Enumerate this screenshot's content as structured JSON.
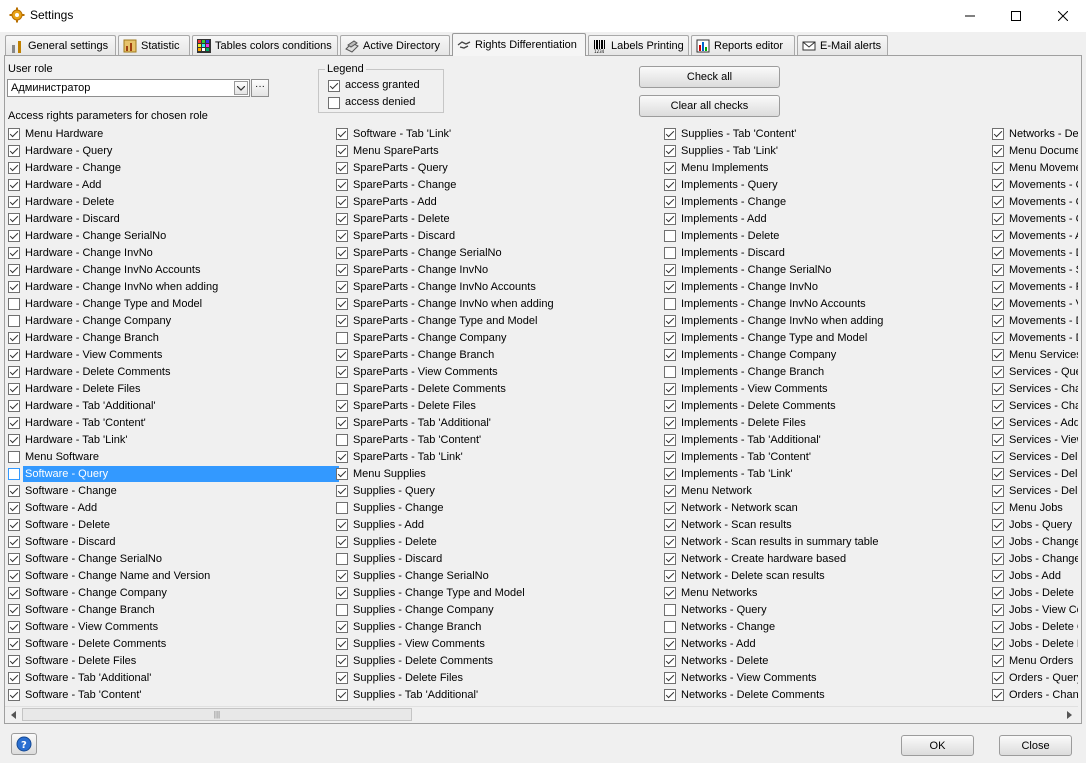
{
  "window": {
    "title": "Settings"
  },
  "tabs": [
    {
      "label": "General settings",
      "icon": "tools-icon",
      "active": false
    },
    {
      "label": "Statistic",
      "icon": "chart-icon",
      "active": false
    },
    {
      "label": "Tables colors conditions",
      "icon": "color-grid-icon",
      "active": false
    },
    {
      "label": "Active Directory",
      "icon": "directory-icon",
      "active": false
    },
    {
      "label": "Rights Differentiation",
      "icon": "handshake-icon",
      "active": true
    },
    {
      "label": "Labels Printing",
      "icon": "barcode-icon",
      "active": false
    },
    {
      "label": "Reports editor",
      "icon": "report-icon",
      "active": false
    },
    {
      "label": "E-Mail alerts",
      "icon": "email-icon",
      "active": false
    }
  ],
  "user_role": {
    "label": "User role",
    "value": "Администратор"
  },
  "legend": {
    "title": "Legend",
    "granted": "access granted",
    "denied": "access denied"
  },
  "buttons": {
    "check_all": "Check all",
    "clear_all": "Clear all checks",
    "ok": "OK",
    "close": "Close"
  },
  "section_label": "Access rights parameters for chosen role",
  "columns": [
    [
      {
        "label": "Menu Hardware",
        "checked": true
      },
      {
        "label": "Hardware - Query",
        "checked": true
      },
      {
        "label": "Hardware - Change",
        "checked": true
      },
      {
        "label": "Hardware - Add",
        "checked": true
      },
      {
        "label": "Hardware - Delete",
        "checked": true
      },
      {
        "label": "Hardware - Discard",
        "checked": true
      },
      {
        "label": "Hardware - Change SerialNo",
        "checked": true
      },
      {
        "label": "Hardware - Change InvNo",
        "checked": true
      },
      {
        "label": "Hardware - Change InvNo Accounts",
        "checked": true
      },
      {
        "label": "Hardware - Change InvNo when adding",
        "checked": true
      },
      {
        "label": "Hardware - Change Type and Model",
        "checked": false
      },
      {
        "label": "Hardware - Change Company",
        "checked": false
      },
      {
        "label": "Hardware - Change Branch",
        "checked": true
      },
      {
        "label": "Hardware - View Comments",
        "checked": true
      },
      {
        "label": "Hardware - Delete Comments",
        "checked": true
      },
      {
        "label": "Hardware - Delete Files",
        "checked": true
      },
      {
        "label": "Hardware - Tab 'Additional'",
        "checked": true
      },
      {
        "label": "Hardware - Tab 'Content'",
        "checked": true
      },
      {
        "label": "Hardware - Tab 'Link'",
        "checked": true
      },
      {
        "label": "Menu Software",
        "checked": false
      },
      {
        "label": "Software - Query",
        "checked": false,
        "selected": true
      },
      {
        "label": "Software - Change",
        "checked": true
      },
      {
        "label": "Software - Add",
        "checked": true
      },
      {
        "label": "Software - Delete",
        "checked": true
      },
      {
        "label": "Software - Discard",
        "checked": true
      },
      {
        "label": "Software - Change SerialNo",
        "checked": true
      },
      {
        "label": "Software - Change Name and Version",
        "checked": true
      },
      {
        "label": "Software - Change Company",
        "checked": true
      },
      {
        "label": "Software - Change Branch",
        "checked": true
      },
      {
        "label": "Software - View Comments",
        "checked": true
      },
      {
        "label": "Software - Delete Comments",
        "checked": true
      },
      {
        "label": "Software - Delete Files",
        "checked": true
      },
      {
        "label": "Software - Tab 'Additional'",
        "checked": true
      },
      {
        "label": "Software - Tab 'Content'",
        "checked": true
      }
    ],
    [
      {
        "label": "Software - Tab 'Link'",
        "checked": true
      },
      {
        "label": "Menu SpareParts",
        "checked": true
      },
      {
        "label": "SpareParts - Query",
        "checked": true
      },
      {
        "label": "SpareParts - Change",
        "checked": true
      },
      {
        "label": "SpareParts - Add",
        "checked": true
      },
      {
        "label": "SpareParts - Delete",
        "checked": true
      },
      {
        "label": "SpareParts - Discard",
        "checked": true
      },
      {
        "label": "SpareParts - Change SerialNo",
        "checked": true
      },
      {
        "label": "SpareParts - Change InvNo",
        "checked": true
      },
      {
        "label": "SpareParts - Change InvNo Accounts",
        "checked": true
      },
      {
        "label": "SpareParts - Change InvNo when adding",
        "checked": true
      },
      {
        "label": "SpareParts - Change Type and Model",
        "checked": true
      },
      {
        "label": "SpareParts - Change Company",
        "checked": false
      },
      {
        "label": "SpareParts - Change Branch",
        "checked": true
      },
      {
        "label": "SpareParts - View Comments",
        "checked": true
      },
      {
        "label": "SpareParts - Delete Comments",
        "checked": false
      },
      {
        "label": "SpareParts - Delete Files",
        "checked": true
      },
      {
        "label": "SpareParts - Tab 'Additional'",
        "checked": true
      },
      {
        "label": "SpareParts - Tab 'Content'",
        "checked": false
      },
      {
        "label": "SpareParts - Tab 'Link'",
        "checked": true
      },
      {
        "label": "Menu Supplies",
        "checked": true
      },
      {
        "label": "Supplies - Query",
        "checked": true
      },
      {
        "label": "Supplies - Change",
        "checked": false
      },
      {
        "label": "Supplies - Add",
        "checked": true
      },
      {
        "label": "Supplies - Delete",
        "checked": true
      },
      {
        "label": "Supplies - Discard",
        "checked": false
      },
      {
        "label": "Supplies - Change SerialNo",
        "checked": true
      },
      {
        "label": "Supplies - Change Type and Model",
        "checked": true
      },
      {
        "label": "Supplies - Change Company",
        "checked": false
      },
      {
        "label": "Supplies - Change Branch",
        "checked": true
      },
      {
        "label": "Supplies - View Comments",
        "checked": true
      },
      {
        "label": "Supplies - Delete Comments",
        "checked": true
      },
      {
        "label": "Supplies - Delete Files",
        "checked": true
      },
      {
        "label": "Supplies - Tab 'Additional'",
        "checked": true
      }
    ],
    [
      {
        "label": "Supplies - Tab 'Content'",
        "checked": true
      },
      {
        "label": "Supplies - Tab 'Link'",
        "checked": true
      },
      {
        "label": "Menu Implements",
        "checked": true
      },
      {
        "label": "Implements - Query",
        "checked": true
      },
      {
        "label": "Implements - Change",
        "checked": true
      },
      {
        "label": "Implements - Add",
        "checked": true
      },
      {
        "label": "Implements - Delete",
        "checked": false
      },
      {
        "label": "Implements - Discard",
        "checked": false
      },
      {
        "label": "Implements - Change SerialNo",
        "checked": true
      },
      {
        "label": "Implements - Change InvNo",
        "checked": true
      },
      {
        "label": "Implements - Change InvNo Accounts",
        "checked": false
      },
      {
        "label": "Implements - Change InvNo when adding",
        "checked": true
      },
      {
        "label": "Implements - Change Type and Model",
        "checked": true
      },
      {
        "label": "Implements - Change Company",
        "checked": true
      },
      {
        "label": "Implements - Change Branch",
        "checked": false
      },
      {
        "label": "Implements - View Comments",
        "checked": true
      },
      {
        "label": "Implements - Delete Comments",
        "checked": true
      },
      {
        "label": "Implements - Delete Files",
        "checked": true
      },
      {
        "label": "Implements - Tab 'Additional'",
        "checked": true
      },
      {
        "label": "Implements - Tab 'Content'",
        "checked": true
      },
      {
        "label": "Implements - Tab 'Link'",
        "checked": true
      },
      {
        "label": "Menu Network",
        "checked": true
      },
      {
        "label": "Network - Network scan",
        "checked": true
      },
      {
        "label": "Network - Scan results",
        "checked": true
      },
      {
        "label": "Network - Scan results in summary table",
        "checked": true
      },
      {
        "label": "Network - Create hardware based",
        "checked": true
      },
      {
        "label": "Network - Delete scan results",
        "checked": true
      },
      {
        "label": "Menu Networks",
        "checked": true
      },
      {
        "label": "Networks - Query",
        "checked": false
      },
      {
        "label": "Networks - Change",
        "checked": false
      },
      {
        "label": "Networks - Add",
        "checked": true
      },
      {
        "label": "Networks - Delete",
        "checked": true
      },
      {
        "label": "Networks - View Comments",
        "checked": true
      },
      {
        "label": "Networks - Delete Comments",
        "checked": true
      }
    ],
    [
      {
        "label": "Networks - Delete Files",
        "checked": true
      },
      {
        "label": "Menu Documents",
        "checked": true
      },
      {
        "label": "Menu Movements",
        "checked": true
      },
      {
        "label": "Movements - Query",
        "checked": true
      },
      {
        "label": "Movements - Change",
        "checked": true
      },
      {
        "label": "Movements - Change Company",
        "checked": true
      },
      {
        "label": "Movements - Add",
        "checked": true
      },
      {
        "label": "Movements - Delete",
        "checked": true
      },
      {
        "label": "Movements - Set Date",
        "checked": true
      },
      {
        "label": "Movements - Report",
        "checked": true
      },
      {
        "label": "Movements - View Comments",
        "checked": true
      },
      {
        "label": "Movements - Delete Comments",
        "checked": true
      },
      {
        "label": "Movements - Delete Files",
        "checked": true
      },
      {
        "label": "Menu Services",
        "checked": true
      },
      {
        "label": "Services - Query",
        "checked": true
      },
      {
        "label": "Services - Change",
        "checked": true
      },
      {
        "label": "Services - Change Company",
        "checked": true
      },
      {
        "label": "Services - Add",
        "checked": true
      },
      {
        "label": "Services - View Comments",
        "checked": true
      },
      {
        "label": "Services - Delete",
        "checked": true
      },
      {
        "label": "Services - Delete Comments",
        "checked": true
      },
      {
        "label": "Services - Delete Files",
        "checked": true
      },
      {
        "label": "Menu Jobs",
        "checked": true
      },
      {
        "label": "Jobs - Query",
        "checked": true
      },
      {
        "label": "Jobs - Change",
        "checked": true
      },
      {
        "label": "Jobs - Change Company",
        "checked": true
      },
      {
        "label": "Jobs - Add",
        "checked": true
      },
      {
        "label": "Jobs - Delete",
        "checked": true
      },
      {
        "label": "Jobs - View Comments",
        "checked": true
      },
      {
        "label": "Jobs - Delete Comments",
        "checked": true
      },
      {
        "label": "Jobs - Delete Files",
        "checked": true
      },
      {
        "label": "Menu Orders",
        "checked": true
      },
      {
        "label": "Orders - Query",
        "checked": true
      },
      {
        "label": "Orders - Change",
        "checked": true
      }
    ]
  ]
}
